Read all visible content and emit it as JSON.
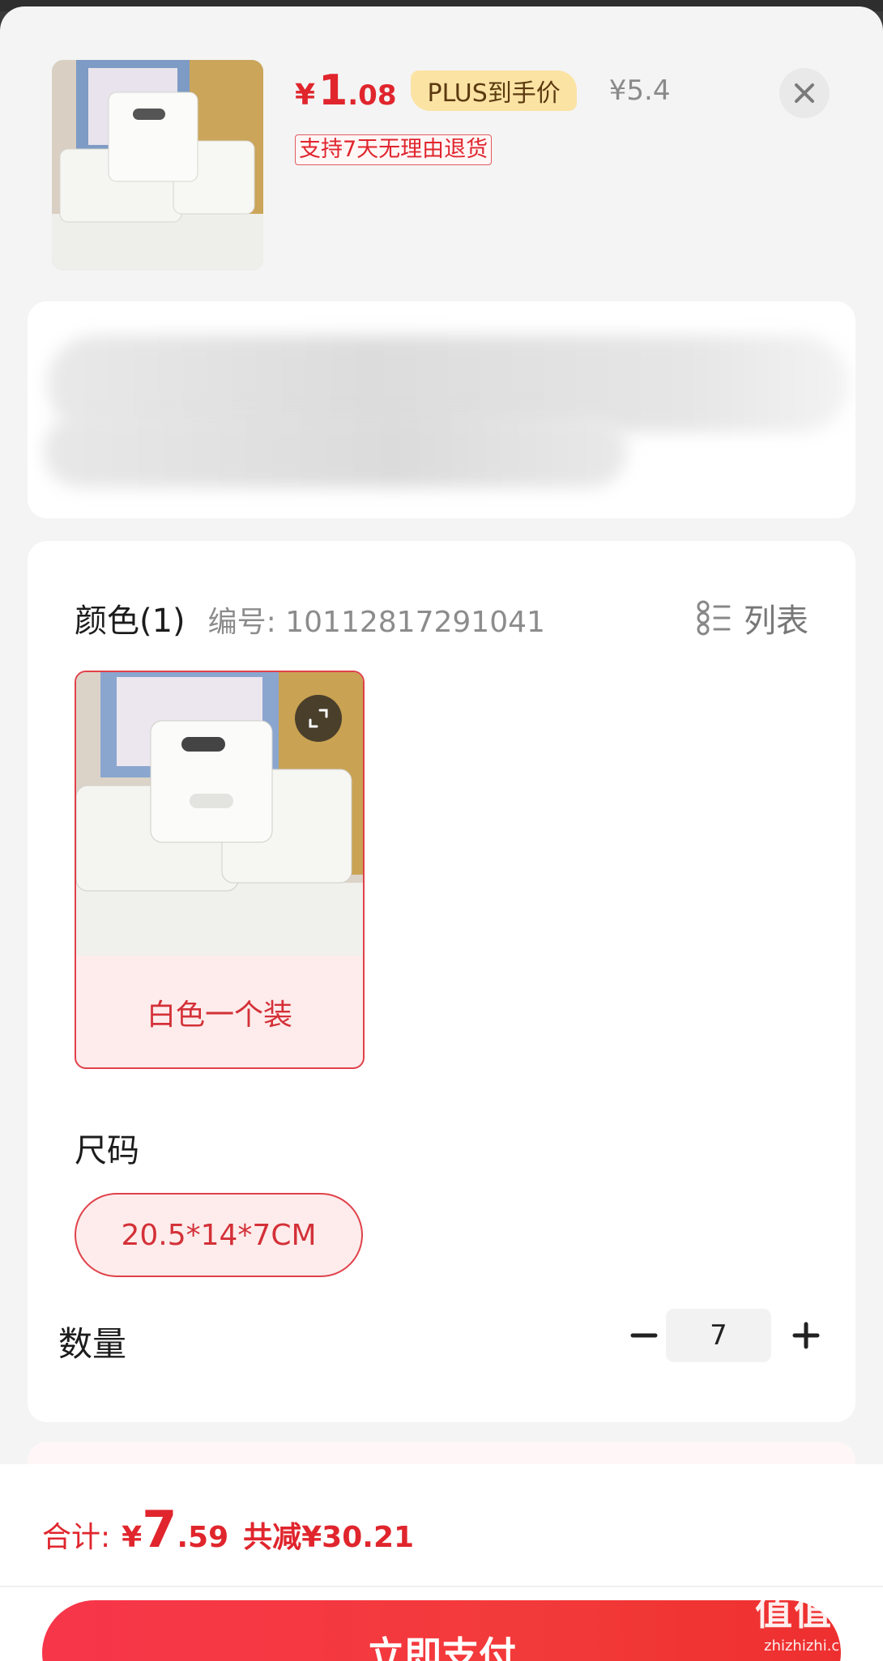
{
  "header": {
    "price_currency": "¥",
    "price_int": "1",
    "price_dec": ".08",
    "plus_tag": "PLUS到手价",
    "original_price": "¥5.4",
    "return_policy": "支持7天无理由退货"
  },
  "options": {
    "color_title": "颜色(1)",
    "color_code": "编号: 10112817291041",
    "list_label": "列表",
    "color_option": "白色一个装",
    "size_title": "尺码",
    "size_option": "20.5*14*7CM",
    "quantity_title": "数量",
    "quantity_value": "7"
  },
  "footer": {
    "total_label": "合计:",
    "total_currency": "¥",
    "total_int": "7",
    "total_dec": ".59",
    "total_saving": "共减¥30.21",
    "pay_button": "立即支付"
  },
  "watermark": {
    "logo": "值值值",
    "url": "zhizhizhi.com"
  },
  "colors": {
    "accent": "#e0252d",
    "plus_tag_bg": "#fbe3a4",
    "selected_bg": "#fdeceb"
  }
}
